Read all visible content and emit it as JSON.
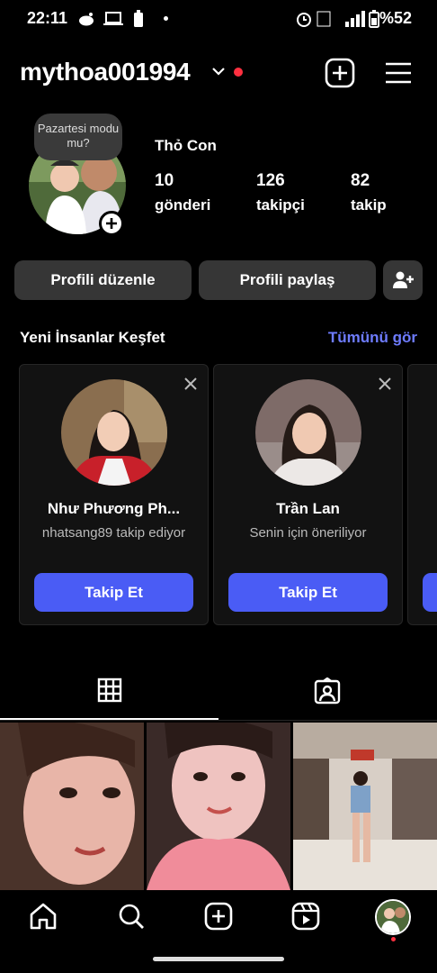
{
  "status_bar": {
    "time": "22:11",
    "battery": "%52"
  },
  "header": {
    "username": "mythoa001994"
  },
  "profile": {
    "note": "Pazartesi modu mu?",
    "full_name": "Thỏ Con",
    "stats": [
      {
        "value": "10",
        "label": "gönderi"
      },
      {
        "value": "126",
        "label": "takipçi"
      },
      {
        "value": "82",
        "label": "takip"
      }
    ]
  },
  "buttons": {
    "edit": "Profili düzenle",
    "share": "Profili paylaş"
  },
  "discover": {
    "title": "Yeni İnsanlar Keşfet",
    "see_all": "Tümünü gör",
    "cards": [
      {
        "name": "Như Phương Ph...",
        "subtitle": "nhatsang89 takip ediyor",
        "button": "Takip Et"
      },
      {
        "name": "Trần Lan",
        "subtitle": "Senin için öneriliyor",
        "button": "Takip Et"
      }
    ]
  },
  "colors": {
    "accent": "#4a5cf5",
    "link": "#6e7cff",
    "notification": "#ff3040"
  }
}
